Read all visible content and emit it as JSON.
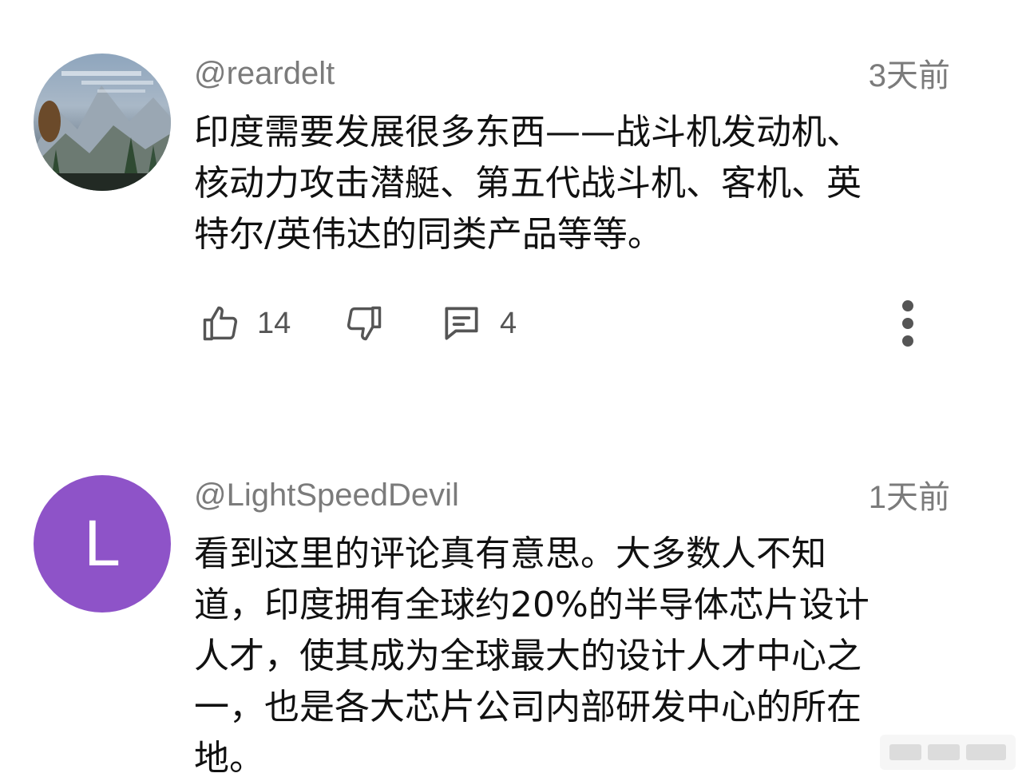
{
  "comments": [
    {
      "username": "@reardelt",
      "timestamp": "3天前",
      "avatar": {
        "type": "photo",
        "description_icon": "landscape-photo-avatar"
      },
      "body_lines": [
        "印度需要发展很多东西——战斗机发动机、",
        "核动力攻击潜艇、第五代战斗机、客机、英",
        "特尔/英伟达的同类产品等等。"
      ],
      "actions": {
        "likes": "14",
        "replies": "4"
      }
    },
    {
      "username": "@LightSpeedDevil",
      "timestamp": "1天前",
      "avatar": {
        "type": "letter",
        "letter": "L",
        "color": "#8e53c8"
      },
      "body_lines": [
        "看到这里的评论真有意思。大多数人不知",
        "道，印度拥有全球约20%的半导体芯片设计",
        "人才，使其成为全球最大的设计人才中心之",
        "一，也是各大芯片公司内部研发中心的所在",
        "地。"
      ]
    }
  ],
  "colors": {
    "meta_text": "#7b7b7b",
    "body_text": "#111111",
    "icon": "#555555",
    "letter_avatar_bg": "#8e53c8"
  },
  "icons": [
    "thumb-up-icon",
    "thumb-down-icon",
    "reply-icon",
    "more-vert-icon"
  ]
}
